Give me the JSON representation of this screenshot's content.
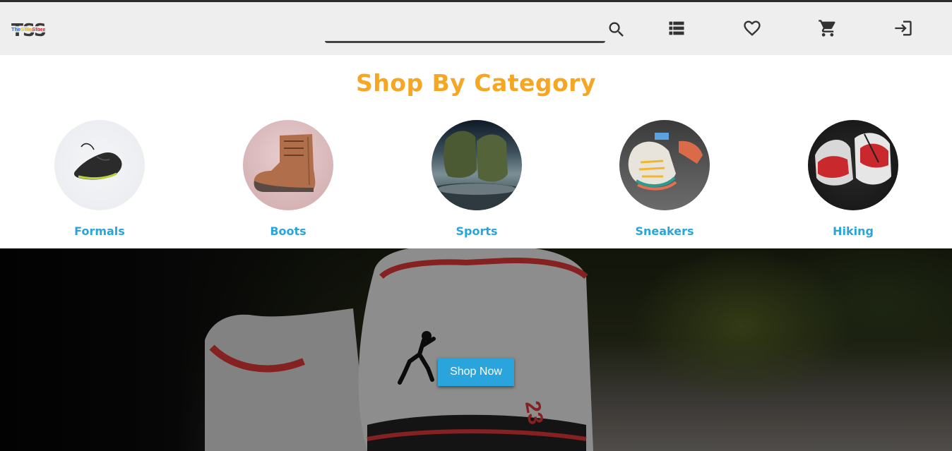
{
  "header": {
    "logo": {
      "big_text": "TSS",
      "small_parts": [
        "The",
        "Sole",
        "Store"
      ]
    },
    "search": {
      "value": "",
      "placeholder": ""
    },
    "icons": [
      "search-icon",
      "list-icon",
      "heart-icon",
      "cart-icon",
      "login-icon"
    ]
  },
  "category_section": {
    "title": "Shop By Category",
    "categories": [
      {
        "label": "Formals"
      },
      {
        "label": "Boots"
      },
      {
        "label": "Sports"
      },
      {
        "label": "Sneakers"
      },
      {
        "label": "Hiking"
      }
    ]
  },
  "hero": {
    "button_label": "Shop Now",
    "shoe_number": "23"
  },
  "colors": {
    "accent_orange": "#f5a623",
    "accent_blue": "#2aa4dc",
    "navbar_bg": "#eeeeee"
  }
}
